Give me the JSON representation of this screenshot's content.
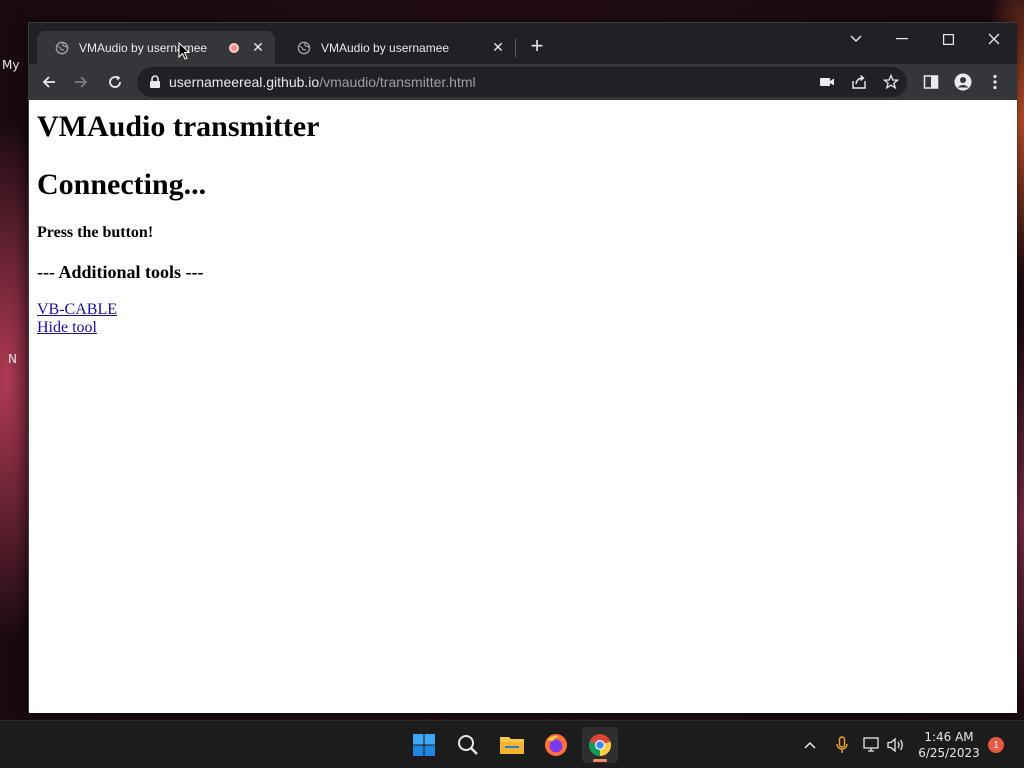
{
  "desktop": {
    "icon_labels": [
      "My",
      "N"
    ]
  },
  "browser": {
    "tabs": [
      {
        "title": "VMAudio by usernamee",
        "active": true,
        "recording": true,
        "close": "✕"
      },
      {
        "title": "VMAudio by usernamee",
        "active": false,
        "recording": false,
        "close": "✕"
      }
    ],
    "new_tab": "+",
    "window_controls": {
      "tab_search": "⌄",
      "minimize": "—",
      "maximize": "☐",
      "close": "✕"
    },
    "address": {
      "host": "usernameereal.github.io",
      "path": "/vmaudio/transmitter.html"
    },
    "icons": [
      "back-icon",
      "forward-icon",
      "reload-icon",
      "lock-icon",
      "camera-icon",
      "share-icon",
      "star-icon",
      "side-panel-icon",
      "profile-icon",
      "menu-icon"
    ]
  },
  "page": {
    "title": "VMAudio transmitter",
    "status": "Connecting...",
    "instruction": "Press the button!",
    "tools_heading": "--- Additional tools ---",
    "links": [
      "VB-CABLE",
      "Hide tool"
    ]
  },
  "taskbar": {
    "apps": [
      "start-icon",
      "search-icon",
      "file-explorer-icon",
      "firefox-icon",
      "chrome-icon"
    ],
    "active_app": "chrome-icon",
    "time": "1:46 AM",
    "date": "6/25/2023",
    "notification_count": "1"
  }
}
